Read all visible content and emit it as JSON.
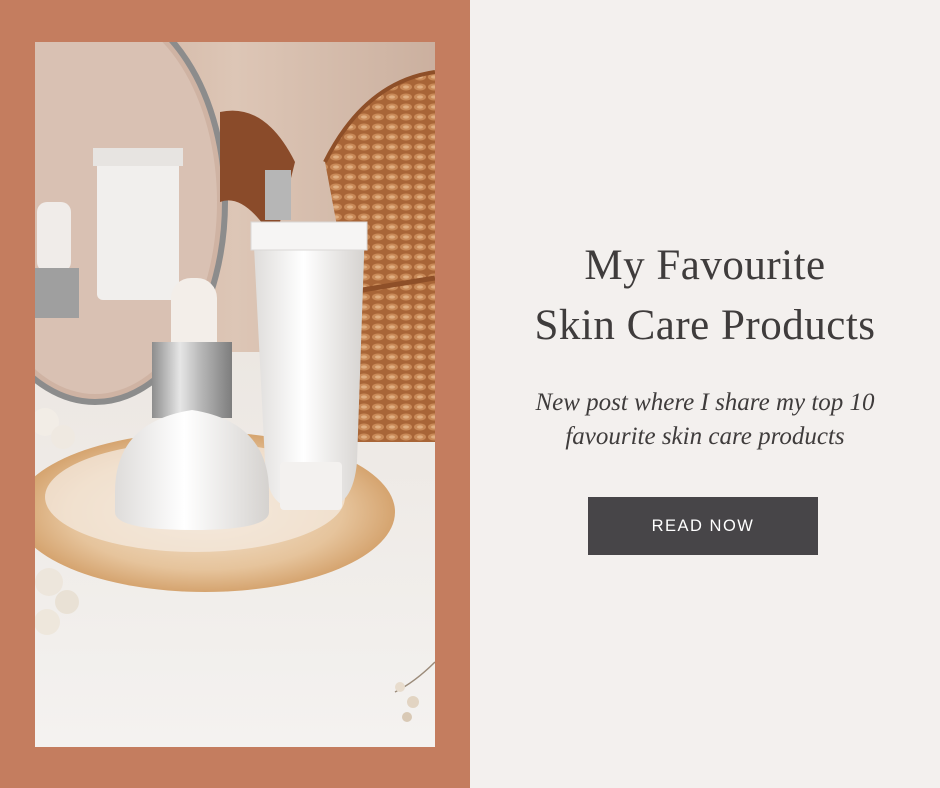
{
  "colors": {
    "left_background": "#c47d5f",
    "right_background": "#f3f0ee",
    "text": "#3f3c3c",
    "button_background": "#474548",
    "button_text": "#ffffff"
  },
  "photo": {
    "icon": "skincare-product-photo"
  },
  "heading": {
    "line1": "My Favourite",
    "line2": "Skin Care Products"
  },
  "subheading": {
    "line1": "New post where I share my top 10",
    "line2": "favourite skin care products"
  },
  "cta": {
    "label": "READ NOW"
  }
}
